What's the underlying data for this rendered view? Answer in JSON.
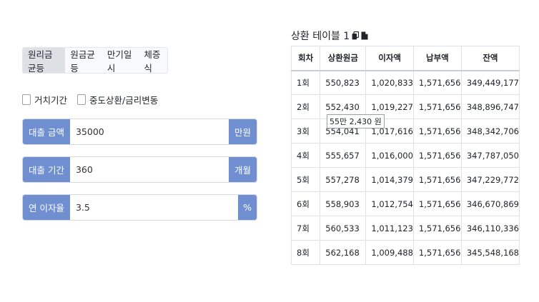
{
  "tabs": [
    "원리금균등",
    "원금균등",
    "만기일시",
    "체증식"
  ],
  "checkboxes": [
    "거치기간",
    "중도상환/금리변동"
  ],
  "inputs": {
    "amount": {
      "label": "대출 금액",
      "value": "35000",
      "unit": "만원"
    },
    "period": {
      "label": "대출 기간",
      "value": "360",
      "unit": "개월"
    },
    "rate": {
      "label": "연 이자율",
      "value": "3.5",
      "unit": "%"
    }
  },
  "table": {
    "title": "상환 테이블 1",
    "headers": [
      "회차",
      "상환원금",
      "이자액",
      "납부액",
      "잔액"
    ],
    "rows": [
      [
        "1회",
        "550,823",
        "1,020,833",
        "1,571,656",
        "349,449,177"
      ],
      [
        "2회",
        "552,430",
        "1,019,227",
        "1,571,656",
        "348,896,747"
      ],
      [
        "3회",
        "554,041",
        "1,017,616",
        "1,571,656",
        "348,342,706"
      ],
      [
        "4회",
        "555,657",
        "1,016,000",
        "1,571,656",
        "347,787,050"
      ],
      [
        "5회",
        "557,278",
        "1,014,379",
        "1,571,656",
        "347,229,772"
      ],
      [
        "6회",
        "558,903",
        "1,012,754",
        "1,571,656",
        "346,670,869"
      ],
      [
        "7회",
        "560,533",
        "1,011,123",
        "1,571,656",
        "346,110,336"
      ],
      [
        "8회",
        "562,168",
        "1,009,488",
        "1,571,656",
        "345,548,168"
      ]
    ]
  },
  "tooltip": "55만 2,430 원"
}
